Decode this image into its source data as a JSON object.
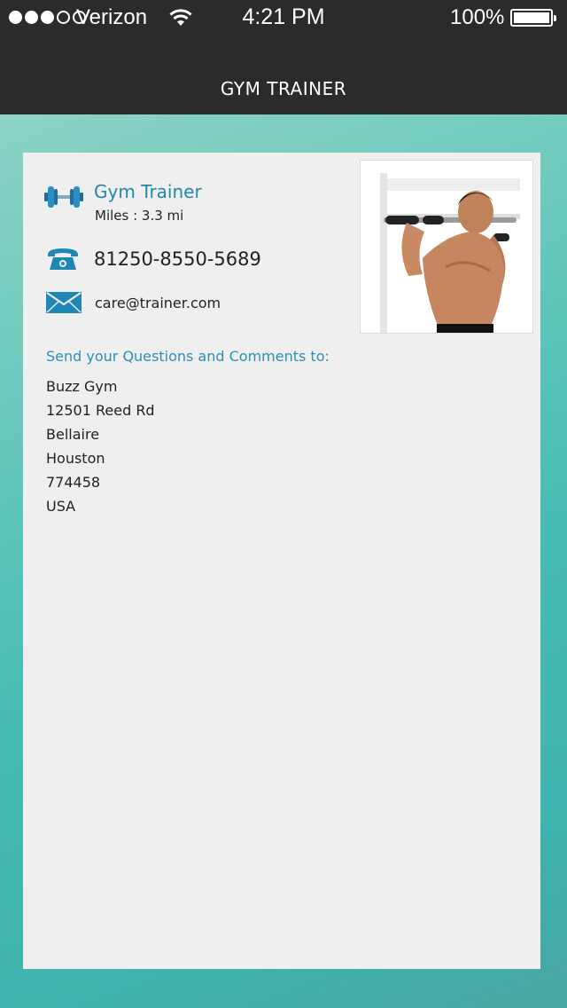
{
  "status_bar": {
    "carrier": "Verizon",
    "time": "4:21 PM",
    "battery": "100%"
  },
  "nav": {
    "title": "GYM TRAINER"
  },
  "trainer": {
    "name": "Gym Trainer",
    "miles": "Miles : 3.3 mi",
    "phone": "81250-8550-5689",
    "email": "care@trainer.com"
  },
  "contact": {
    "heading": "Send your Questions and Comments to:",
    "address_lines": [
      "Buzz Gym",
      "12501 Reed Rd",
      "Bellaire",
      "Houston",
      "774458",
      "USA"
    ]
  },
  "colors": {
    "accent": "#2288aa",
    "bar": "#2b2b2b",
    "card": "#efefef"
  }
}
